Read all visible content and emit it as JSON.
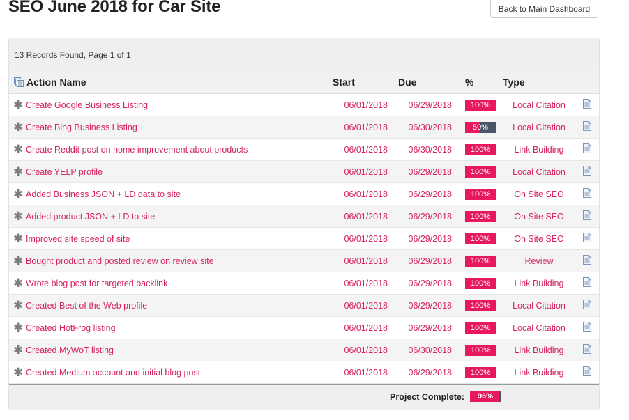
{
  "page": {
    "title": "SEO June 2018 for Car Site",
    "back_button": "Back to Main Dashboard"
  },
  "summary": {
    "records_text": "13 Records Found, Page 1 of 1"
  },
  "table": {
    "headers": {
      "name": "Action Name",
      "start": "Start",
      "due": "Due",
      "pct": "%",
      "type": "Type"
    },
    "rows": [
      {
        "name": "Create Google Business Listing",
        "start": "06/01/2018",
        "due": "06/29/2018",
        "percent": 100,
        "percent_label": "100%",
        "type": "Local Citation"
      },
      {
        "name": "Create Bing Business Listing",
        "start": "06/01/2018",
        "due": "06/30/2018",
        "percent": 50,
        "percent_label": "50%",
        "type": "Local Citation"
      },
      {
        "name": "Create Reddit post on home improvement about products",
        "start": "06/01/2018",
        "due": "06/30/2018",
        "percent": 100,
        "percent_label": "100%",
        "type": "Link Building"
      },
      {
        "name": "Create YELP profile",
        "start": "06/01/2018",
        "due": "06/29/2018",
        "percent": 100,
        "percent_label": "100%",
        "type": "Local Citation"
      },
      {
        "name": "Added Business JSON + LD data to site",
        "start": "06/01/2018",
        "due": "06/29/2018",
        "percent": 100,
        "percent_label": "100%",
        "type": "On Site SEO"
      },
      {
        "name": "Added product JSON + LD to site",
        "start": "06/01/2018",
        "due": "06/29/2018",
        "percent": 100,
        "percent_label": "100%",
        "type": "On Site SEO"
      },
      {
        "name": "Improved site speed of site",
        "start": "06/01/2018",
        "due": "06/29/2018",
        "percent": 100,
        "percent_label": "100%",
        "type": "On Site SEO"
      },
      {
        "name": "Bought product and posted review on review site",
        "start": "06/01/2018",
        "due": "06/29/2018",
        "percent": 100,
        "percent_label": "100%",
        "type": "Review"
      },
      {
        "name": "Wrote blog post for targeted backlink",
        "start": "06/01/2018",
        "due": "06/29/2018",
        "percent": 100,
        "percent_label": "100%",
        "type": "Link Building"
      },
      {
        "name": "Created Best of the Web profile",
        "start": "06/01/2018",
        "due": "06/29/2018",
        "percent": 100,
        "percent_label": "100%",
        "type": "Local Citation"
      },
      {
        "name": "Created HotFrog listing",
        "start": "06/01/2018",
        "due": "06/29/2018",
        "percent": 100,
        "percent_label": "100%",
        "type": "Local Citation"
      },
      {
        "name": "Created MyWoT listing",
        "start": "06/01/2018",
        "due": "06/30/2018",
        "percent": 100,
        "percent_label": "100%",
        "type": "Link Building"
      },
      {
        "name": "Created Medium account and initial blog post",
        "start": "06/01/2018",
        "due": "06/29/2018",
        "percent": 100,
        "percent_label": "100%",
        "type": "Link Building"
      }
    ]
  },
  "footer": {
    "complete_label": "Project Complete:",
    "complete_percent": 96,
    "complete_percent_label": "96%"
  },
  "colors": {
    "accent": "#d6245c",
    "progress_fill": "#e8185c",
    "progress_track": "#4a5568"
  },
  "icons": {
    "header": "records-icon",
    "row_action": "gear-icon",
    "row_detail": "document-icon"
  }
}
